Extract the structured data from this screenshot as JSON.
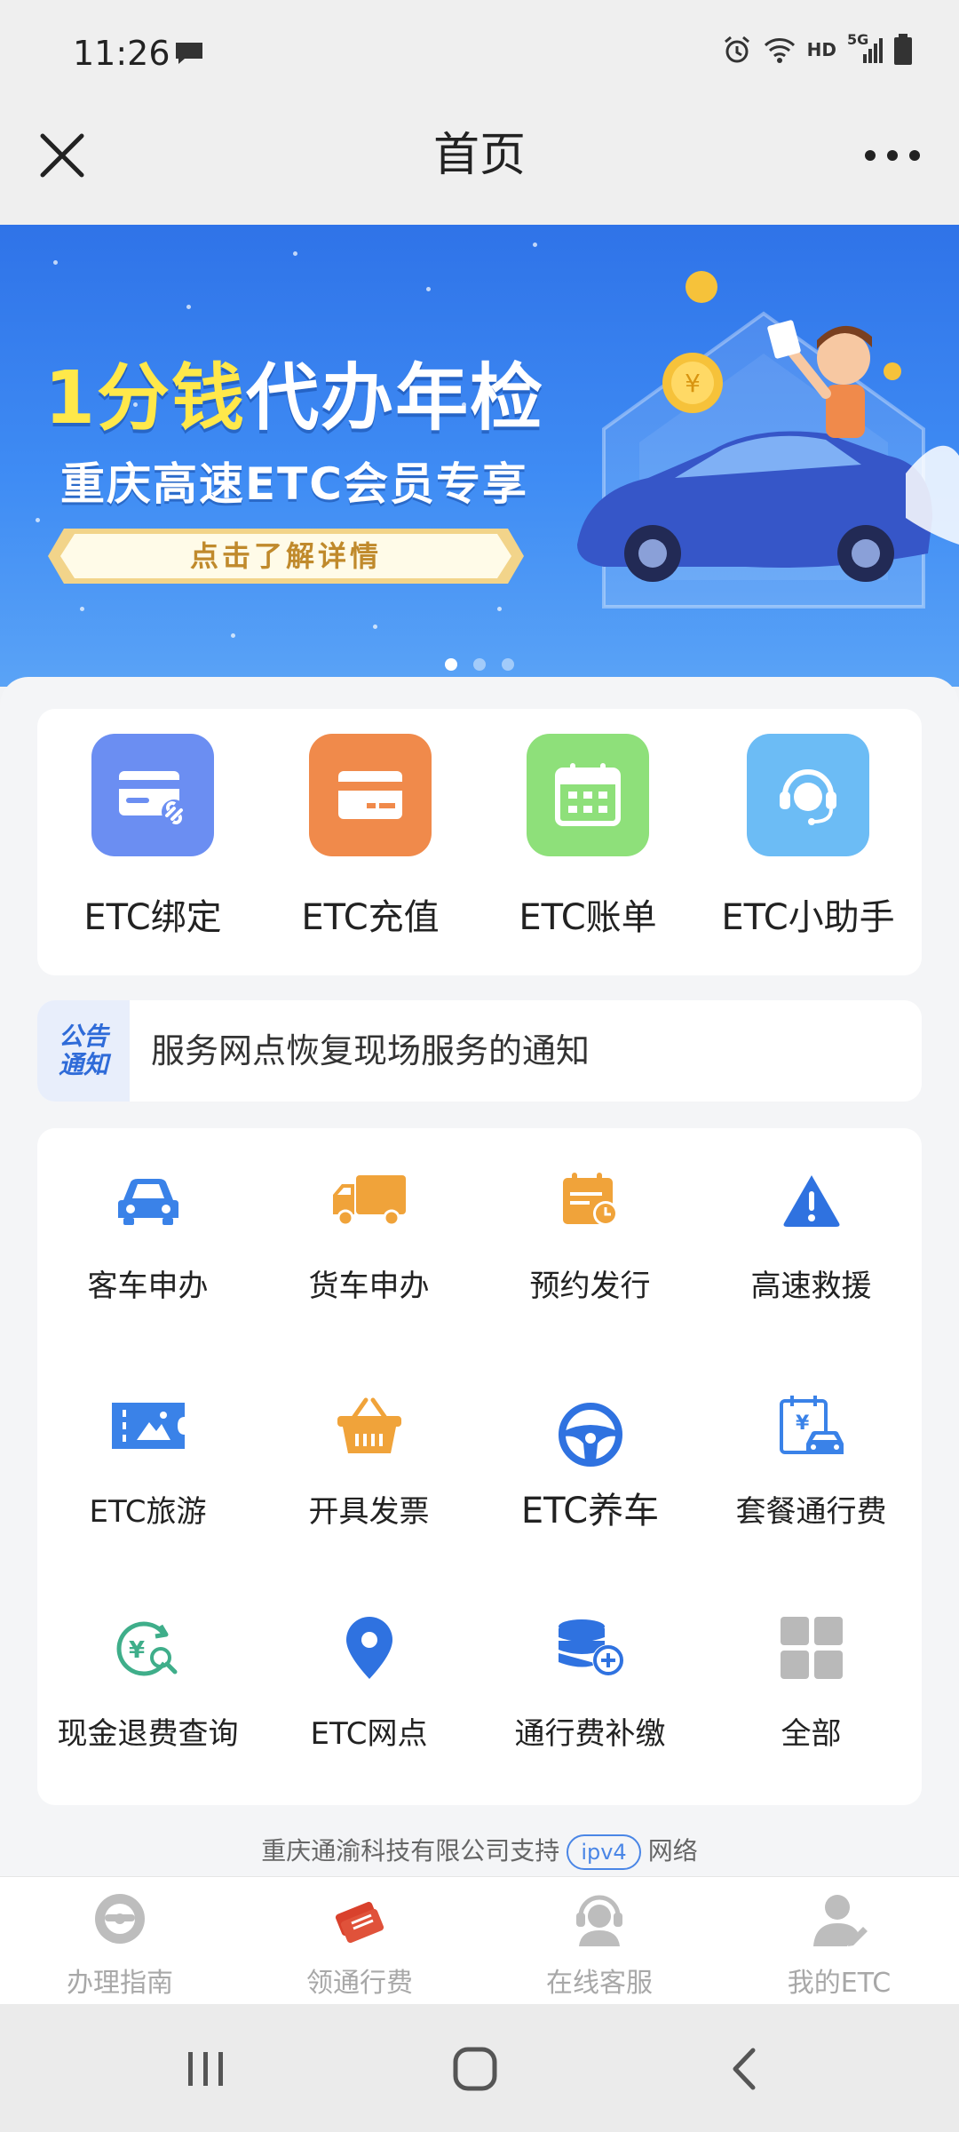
{
  "status_bar": {
    "time": "11:26",
    "network_label": "HD",
    "signal_label": "5G"
  },
  "title_bar": {
    "title": "首页"
  },
  "banner": {
    "headline_highlight": "1分钱",
    "headline_rest": "代办年检",
    "subtitle": "重庆高速ETC会员专享",
    "cta": "点击了解详情",
    "active_slide": 1,
    "slide_count": 3
  },
  "quick_actions": [
    {
      "label": "ETC绑定",
      "icon": "card-link-icon",
      "color": "#6b8ef2"
    },
    {
      "label": "ETC充值",
      "icon": "card-recharge-icon",
      "color": "#f08a4b"
    },
    {
      "label": "ETC账单",
      "icon": "calendar-icon",
      "color": "#8ee07a"
    },
    {
      "label": "ETC小助手",
      "icon": "headset-agent-icon",
      "color": "#6cbcf5"
    }
  ],
  "notice": {
    "tag_line1": "公告",
    "tag_line2": "通知",
    "text": "服务网点恢复现场服务的通知"
  },
  "services": [
    {
      "label": "客车申办",
      "icon": "car-icon"
    },
    {
      "label": "货车申办",
      "icon": "truck-icon"
    },
    {
      "label": "预约发行",
      "icon": "calendar-clock-icon"
    },
    {
      "label": "高速救援",
      "icon": "warning-icon"
    },
    {
      "label": "ETC旅游",
      "icon": "ticket-icon"
    },
    {
      "label": "开具发票",
      "icon": "basket-icon"
    },
    {
      "label": "ETC养车",
      "icon": "steering-wheel-icon"
    },
    {
      "label": "套餐通行费",
      "icon": "toll-package-icon"
    },
    {
      "label": "现金退费查询",
      "icon": "refund-search-icon"
    },
    {
      "label": "ETC网点",
      "icon": "location-pin-icon"
    },
    {
      "label": "通行费补缴",
      "icon": "coins-add-icon"
    },
    {
      "label": "全部",
      "icon": "grid-icon"
    }
  ],
  "support": {
    "text": "重庆通渝科技有限公司支持",
    "badge": "ipv4",
    "suffix": "网络"
  },
  "tabs": [
    {
      "label": "办理指南",
      "icon": "steering-wheel-icon"
    },
    {
      "label": "领通行费",
      "icon": "tickets-icon"
    },
    {
      "label": "在线客服",
      "icon": "customer-service-icon"
    },
    {
      "label": "我的ETC",
      "icon": "user-icon"
    }
  ],
  "colors": {
    "accent": "#4a86e6",
    "banner_top": "#2f73e8",
    "active_tab_icon": "#d9412c"
  }
}
